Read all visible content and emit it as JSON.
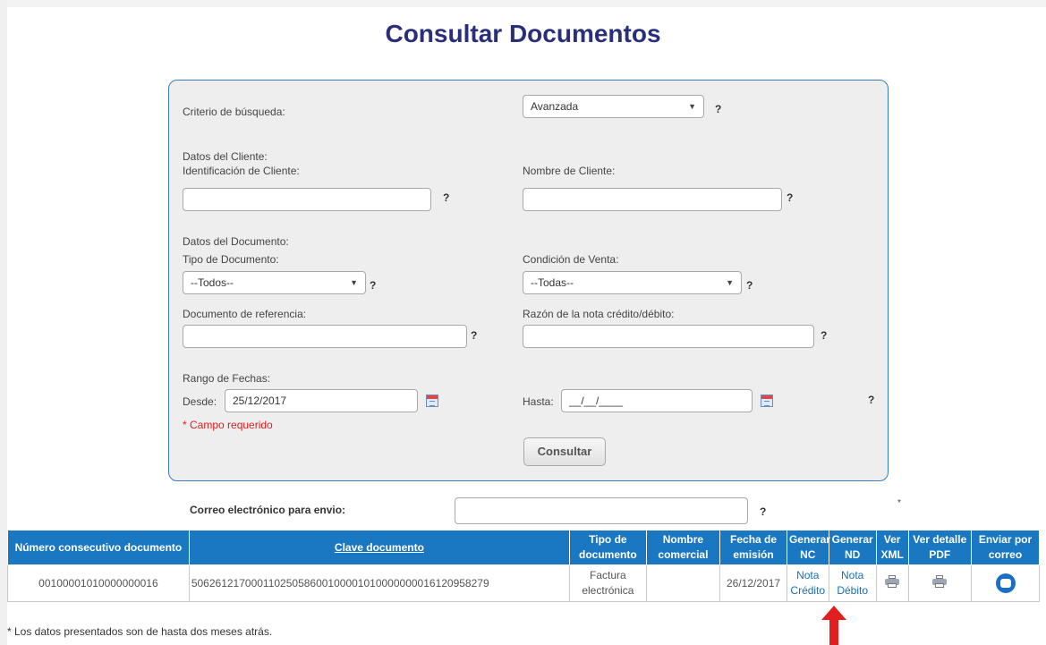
{
  "page": {
    "title": "Consultar Documentos"
  },
  "form": {
    "criterio_label": "Criterio de búsqueda:",
    "criterio_value": "Avanzada",
    "datos_cliente_label": "Datos del Cliente:",
    "identificacion_label": "Identificación de Cliente:",
    "identificacion_value": "",
    "nombre_cliente_label": "Nombre de Cliente:",
    "nombre_cliente_value": "",
    "datos_documento_label": "Datos del Documento:",
    "tipo_documento_label": "Tipo de Documento:",
    "tipo_documento_value": "--Todos--",
    "condicion_venta_label": "Condición de Venta:",
    "condicion_venta_value": "--Todas--",
    "documento_referencia_label": "Documento de referencia:",
    "documento_referencia_value": "",
    "razon_nota_label": "Razón de la nota crédito/débito:",
    "razon_nota_value": "",
    "rango_fechas_label": "Rango de Fechas:",
    "desde_label": "Desde:",
    "desde_value": "25/12/2017",
    "hasta_label": "Hasta:",
    "hasta_value": "__/__/____",
    "required_note": "* Campo requerido",
    "consultar_button": "Consultar",
    "help_mark": "?"
  },
  "email": {
    "label": "Correo electrónico para envio:",
    "value": "",
    "asterisk": "*"
  },
  "table": {
    "headers": {
      "numero": "Número consecutivo documento",
      "clave": "Clave documento",
      "tipo": "Tipo de documento",
      "nombre": "Nombre comercial",
      "fecha": "Fecha de emisión",
      "generar_nc": "Generar NC",
      "generar_nd": "Generar ND",
      "ver_xml": "Ver XML",
      "ver_pdf": "Ver detalle PDF",
      "enviar": "Enviar por correo"
    },
    "rows": [
      {
        "numero": "00100001010000000016",
        "clave": "50626121700011025058600100001010000000016120958279",
        "tipo": "Factura electrónica",
        "nombre": "",
        "fecha": "26/12/2017",
        "nc_link": "Nota Crédito",
        "nd_link": "Nota Débito",
        "xml_icon": "printer-icon",
        "pdf_icon": "printer-icon",
        "mail_icon": "mail-icon"
      }
    ]
  },
  "footer": {
    "note": "* Los datos presentados son de hasta dos meses atrás."
  },
  "colors": {
    "title": "#2b2f7a",
    "header_bg": "#1a78c2",
    "required": "#e21b1b",
    "arrow": "#e11f1f"
  }
}
